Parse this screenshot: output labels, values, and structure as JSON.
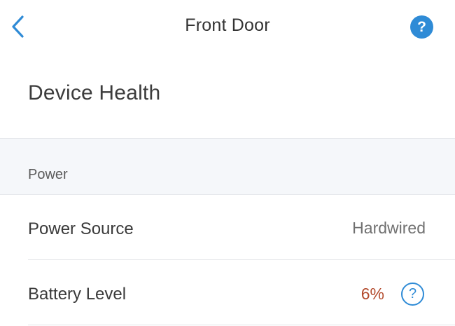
{
  "nav": {
    "title": "Front Door",
    "back_icon": "chevron-left-icon",
    "help_label": "?",
    "help_icon": "question-circle-filled-icon"
  },
  "page": {
    "title": "Device Health"
  },
  "section": {
    "header": "Power",
    "rows": [
      {
        "label": "Power Source",
        "value": "Hardwired"
      },
      {
        "label": "Battery Level",
        "value": "6%",
        "info_label": "?",
        "info_icon": "question-circle-outline-icon"
      }
    ]
  },
  "colors": {
    "accent": "#2f8bd6",
    "battery_low": "#b34a2c",
    "section_bg": "#f5f7fa"
  }
}
